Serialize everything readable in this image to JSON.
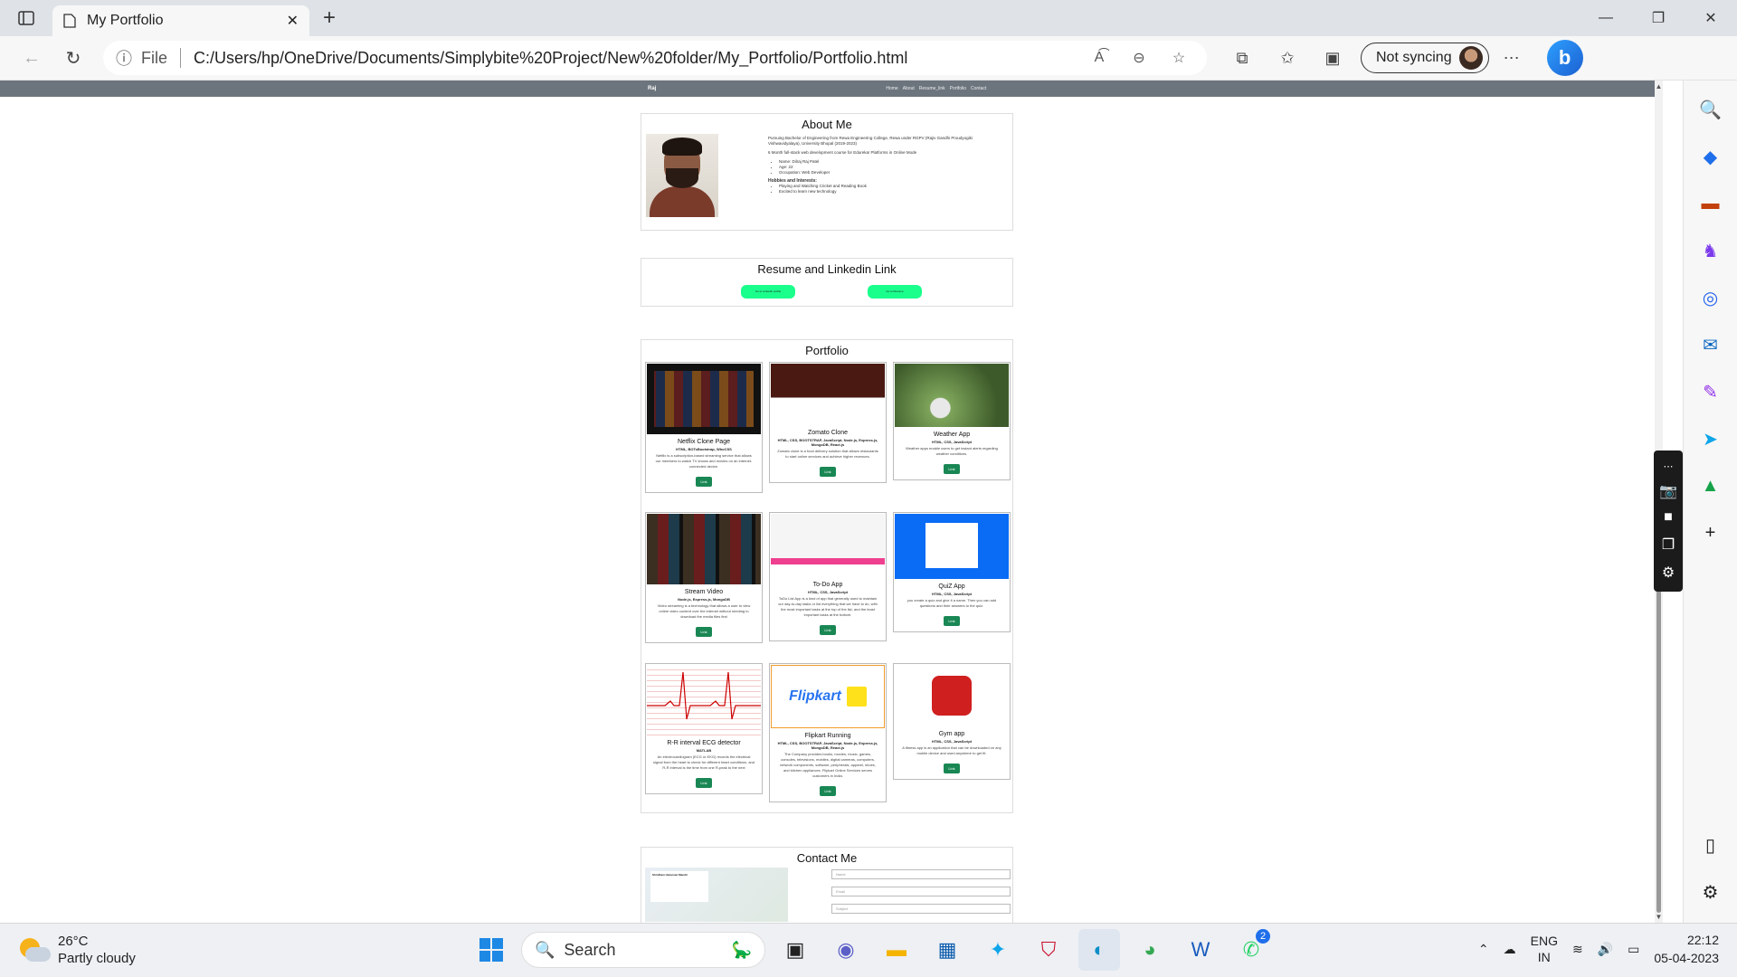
{
  "browser": {
    "tab_title": "My Portfolio",
    "url_scheme_label": "File",
    "url": "C:/Users/hp/OneDrive/Documents/Simplybite%20Project/New%20folder/My_Portfolio/Portfolio.html",
    "sync_label": "Not syncing"
  },
  "site": {
    "brand": "Raj",
    "nav": [
      "Home",
      "About",
      "Resume_link",
      "Portfolio",
      "Contact"
    ],
    "about": {
      "title": "About Me",
      "p1": "Pursuing Bachelor of Engineering from Rewa Engineering College, Rewa under RGPV (Rajiv Gandhi Proudyogiki Vishwavidyalaya), University Bhopal (2019-2023)",
      "p2": "6 Month full-stack web development course for Edureka! Platforms in Online Mode",
      "details": [
        "Name: Dilraj Raj Patel",
        "Age: 22",
        "Occupation: Web Developer"
      ],
      "hobbies_title": "Hobbies and Interests:",
      "hobbies": [
        "Playing and Watching Cricket and Reading Book",
        "Excited to learn new technology"
      ]
    },
    "resume": {
      "title": "Resume and Linkedin Link",
      "btn1": "Go to Linkedin profile",
      "btn2": "Go to Resume"
    },
    "portfolio": {
      "title": "Portfolio",
      "projects": [
        {
          "name": "Netflix Clone Page",
          "tech": "HTML, BOTsBootstrap, WhoCSS",
          "desc": "Netflix is a subscription-based streaming service that allows our members to watch TV shows and movies on an internet-connected device.",
          "link": "Link"
        },
        {
          "name": "Zomato Clone",
          "tech": "HTML, CSS, BOOTSTRAP, JavaScript, Node.js, Express.js, MongoDB, React.js",
          "desc": "Zomato clone is a food delivery solution that allows restaurants to start online services and achieve higher revenues.",
          "link": "Link"
        },
        {
          "name": "Weather App",
          "tech": "HTML, CSS, JavaScript",
          "desc": "Weather apps enable users to get instant alerts regarding weather conditions.",
          "link": "Link"
        },
        {
          "name": "Stream Video",
          "tech": "Node.js, Express.js, MongoDB",
          "desc": "Video streaming is a technology that allows a user to view online video content over the internet without needing to download the media files first",
          "link": "Link"
        },
        {
          "name": "To-Do App",
          "tech": "HTML, CSS, JavaScript",
          "desc": "ToDo List App is a kind of app that generally used to maintain our day-to-day tasks or list everything that we have to do, with the most important tasks at the top of the list, and the least important tasks at the bottom.",
          "link": "Link"
        },
        {
          "name": "QuiZ App",
          "tech": "HTML, CSS, JavaScript",
          "desc": "you create a quiz and give it a name. Then you can add questions and their answers to the quiz.",
          "link": "Link"
        },
        {
          "name": "R-R interval ECG detector",
          "tech": "MATLAB",
          "desc": "An electrocardiogram (ECG or EKG) records the electrical signal from the heart to check for different heart conditions. and R-R interval is the time from one R-peak to the next",
          "link": "Link"
        },
        {
          "name": "Flipkart Running",
          "tech": "HTML, CSS, BOOTSTRAP, JavaScript, Node.js, Express.js, MongoDB, React.js",
          "desc": "The Company provides books, movies, music, games, consoles, televisions, mobiles, digital cameras, computers, network components, software, peripherals, apparel, shoes, and kitchen appliances. Flipkart Online Services serves customers in India.",
          "link": "Link"
        },
        {
          "name": "Gym app",
          "tech": "HTML, CSS, JavaScript",
          "desc": "A fitness app is an application that can be downloaded on any mobile device and used anywhere to get fit.",
          "link": "Link"
        }
      ]
    },
    "contact": {
      "title": "Contact Me",
      "map_place": "Shridham Hanuman Mandir",
      "fields": [
        "Name",
        "Email",
        "Subject"
      ]
    }
  },
  "taskbar": {
    "temp": "26°C",
    "weather": "Partly cloudy",
    "search": "Search",
    "lang1": "ENG",
    "lang2": "IN",
    "time": "22:12",
    "date": "05-04-2023",
    "whatsapp_badge": "2"
  }
}
